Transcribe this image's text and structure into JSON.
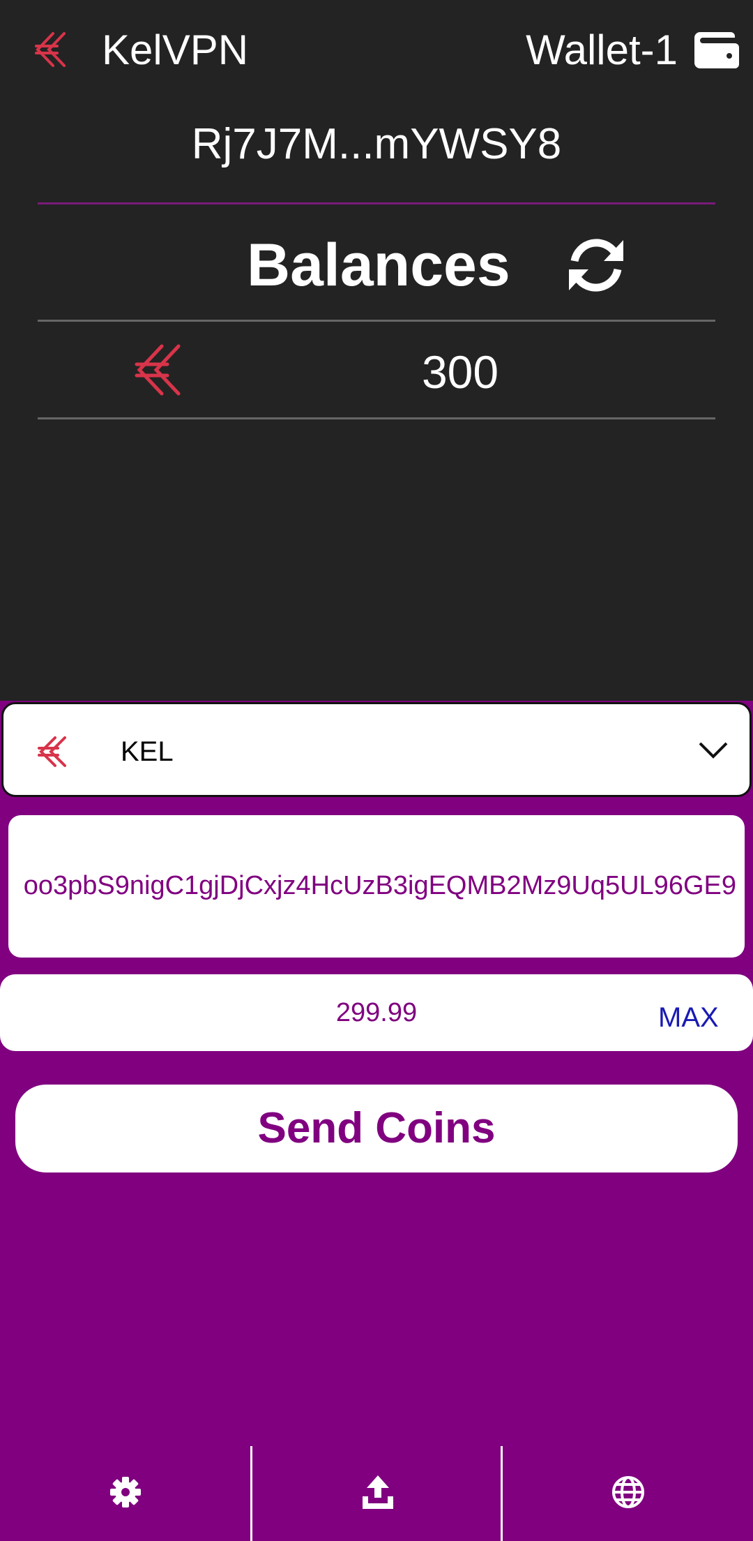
{
  "header": {
    "app_title": "KelVPN",
    "wallet_name": "Wallet-1",
    "logo_icon": "kelvpn-logo-icon",
    "wallet_icon": "wallet-icon"
  },
  "wallet": {
    "address_short": "Rj7J7M...mYWSY8"
  },
  "balances": {
    "title": "Balances",
    "refresh_icon": "refresh-icon",
    "rows": [
      {
        "token_icon": "kel-token-icon",
        "amount": "300"
      }
    ]
  },
  "send_form": {
    "coin_select": {
      "value": "KEL",
      "icon": "kel-token-icon"
    },
    "recipient_address": "oo3pbS9nigC1gjDjCxjz4HcUzB3igEQMB2Mz9Uq5UL96GE9",
    "amount": "299.99",
    "max_label": "MAX",
    "send_label": "Send Coins"
  },
  "bottom_nav": {
    "items": [
      {
        "icon": "gear-icon"
      },
      {
        "icon": "upload-icon"
      },
      {
        "icon": "globe-icon"
      }
    ]
  },
  "colors": {
    "background_dark": "#232323",
    "accent_purple": "#800080",
    "logo_red": "#d8344a",
    "max_blue": "#1a1ab3"
  }
}
